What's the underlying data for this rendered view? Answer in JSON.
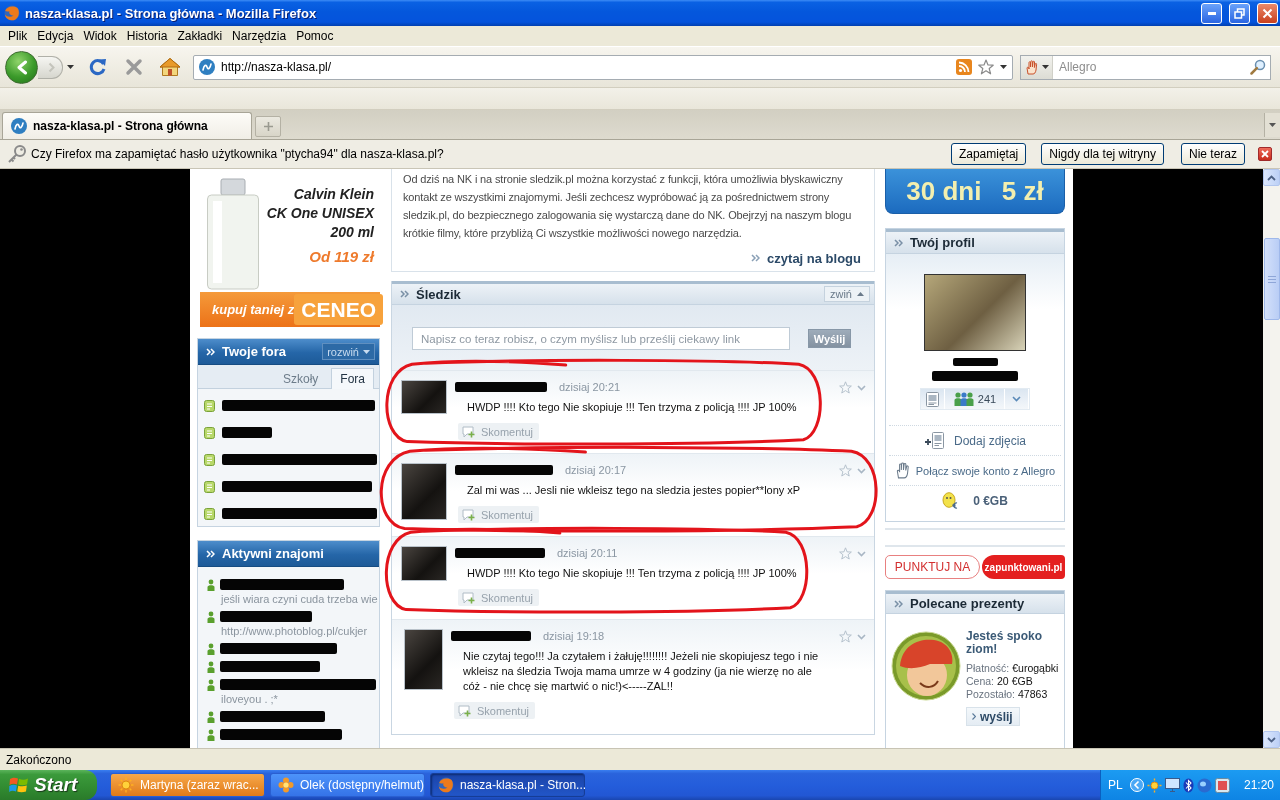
{
  "window": {
    "title": "nasza-klasa.pl - Strona główna - Mozilla Firefox"
  },
  "menu": [
    "Plik",
    "Edycja",
    "Widok",
    "Historia",
    "Zakładki",
    "Narzędzia",
    "Pomoc"
  ],
  "navigation": {
    "url": "http://nasza-klasa.pl/",
    "search_placeholder": "Allegro"
  },
  "tabs": [
    {
      "label": "nasza-klasa.pl - Strona główna",
      "selected": true
    }
  ],
  "notification": {
    "message": "Czy Firefox ma zapamiętać hasło użytkownika \"ptycha94\" dla nasza-klasa.pl?",
    "buttons": [
      "Zapamiętaj",
      "Nigdy dla tej witryny",
      "Nie teraz"
    ]
  },
  "ad": {
    "lines": [
      "Calvin Klein",
      "CK One UNISEX",
      "200 ml"
    ],
    "price": "Od 119 zł",
    "slogan": "kupuj taniej z",
    "brand": "CENEO"
  },
  "forums": {
    "title": "Twoje fora",
    "toggle": "rozwiń",
    "tabs": [
      {
        "label": "Szkoły",
        "selected": false
      },
      {
        "label": "Fora",
        "selected": true
      }
    ],
    "items": [
      {
        "redacted": true
      },
      {
        "redacted": true
      },
      {
        "redacted": true
      },
      {
        "redacted": true
      },
      {
        "redacted": true
      }
    ]
  },
  "friends": {
    "title": "Aktywni znajomi",
    "items": [
      {
        "redacted": true,
        "status": "jeśli wiara czyni cuda trzeba wie"
      },
      {
        "redacted": true,
        "status": "http://www.photoblog.pl/cukjer"
      },
      {
        "redacted": true
      },
      {
        "redacted": true
      },
      {
        "redacted": true,
        "status": "iloveyou . ;*"
      },
      {
        "redacted": true
      },
      {
        "redacted": true
      }
    ]
  },
  "blog": {
    "text": "Od dziś na NK i na stronie sledzik.pl można korzystać z funkcji, która umożliwia błyskawiczny kontakt ze wszystkimi znajomymi. Jeśli zechcesz wypróbować ją za pośrednictwem strony sledzik.pl, do bezpiecznego zalogowania się wystarczą dane do NK. Obejrzyj na naszym blogu krótkie filmy, które przybliżą Ci wszystkie możliwości nowego narzędzia.",
    "link": "czytaj na blogu"
  },
  "sledzik": {
    "title": "Śledzik",
    "toggle": "zwiń",
    "placeholder": "Napisz co teraz robisz, o czym myślisz lub prześlij ciekawy link",
    "send": "Wyślij",
    "posts": [
      {
        "redacted": true,
        "time": "dzisiaj 20:21",
        "text": "HWDP !!!! Kto tego Nie skopiuje !!! Ten trzyma z policją !!!! JP 100%",
        "comment": "Skomentuj",
        "circled": true
      },
      {
        "redacted": true,
        "time": "dzisiaj 20:17",
        "text": "Zal mi was ... Jesli nie wkleisz tego na sledzia jestes popier**lony xP",
        "comment": "Skomentuj",
        "circled": true
      },
      {
        "redacted": true,
        "time": "dzisiaj 20:11",
        "text": "HWDP !!!! Kto tego Nie skopiuje !!! Ten trzyma z policją !!!! JP 100%",
        "comment": "Skomentuj",
        "circled": true
      },
      {
        "redacted": true,
        "time": "dzisiaj 19:18",
        "text": "Nie czytaj tego!!! Ja czytałem i żałuję!!!!!!!! Jeżeli nie skopiujesz tego i nie wkleisz na śledzia Twoja mama umrze w 4 godziny (ja nie wierzę no ale cóż - nie chcę się martwić o nic!)<-----ZAL!!",
        "comment": "Skomentuj",
        "circled": false
      }
    ]
  },
  "promo": {
    "duration": "30 dni",
    "price": "5 zł"
  },
  "profile": {
    "title": "Twój profil",
    "name_redacted": true,
    "friends_count": "241",
    "actions": [
      {
        "kind": "add-photos",
        "label": "Dodaj zdjęcia"
      },
      {
        "kind": "allegro",
        "label": "Połącz swoje konto z Allegro"
      }
    ],
    "balance": "0 €GB"
  },
  "points": {
    "label": "PUNKTUJ NA",
    "site": "zapunktowani.pl"
  },
  "gifts": {
    "title": "Polecane prezenty",
    "name": "Jesteś spoko ziom!",
    "details": [
      {
        "label": "Płatność:",
        "value": "€urogąbki"
      },
      {
        "label": "Cena:",
        "value": "20 €GB"
      },
      {
        "label": "Pozostało:",
        "value": "47863"
      }
    ],
    "button": "wyślij"
  },
  "status_bar": "Zakończono",
  "taskbar": {
    "start": "Start",
    "items": [
      {
        "kind": "away",
        "label": "Martyna (zaraz wrac...",
        "selected": false,
        "attention": true
      },
      {
        "kind": "available",
        "label": "Olek (dostępny/helmut)",
        "selected": false,
        "attention": false
      },
      {
        "kind": "browser",
        "label": "nasza-klasa.pl - Stron...",
        "selected": true,
        "attention": false
      }
    ],
    "language": "PL",
    "clock": "21:20"
  }
}
